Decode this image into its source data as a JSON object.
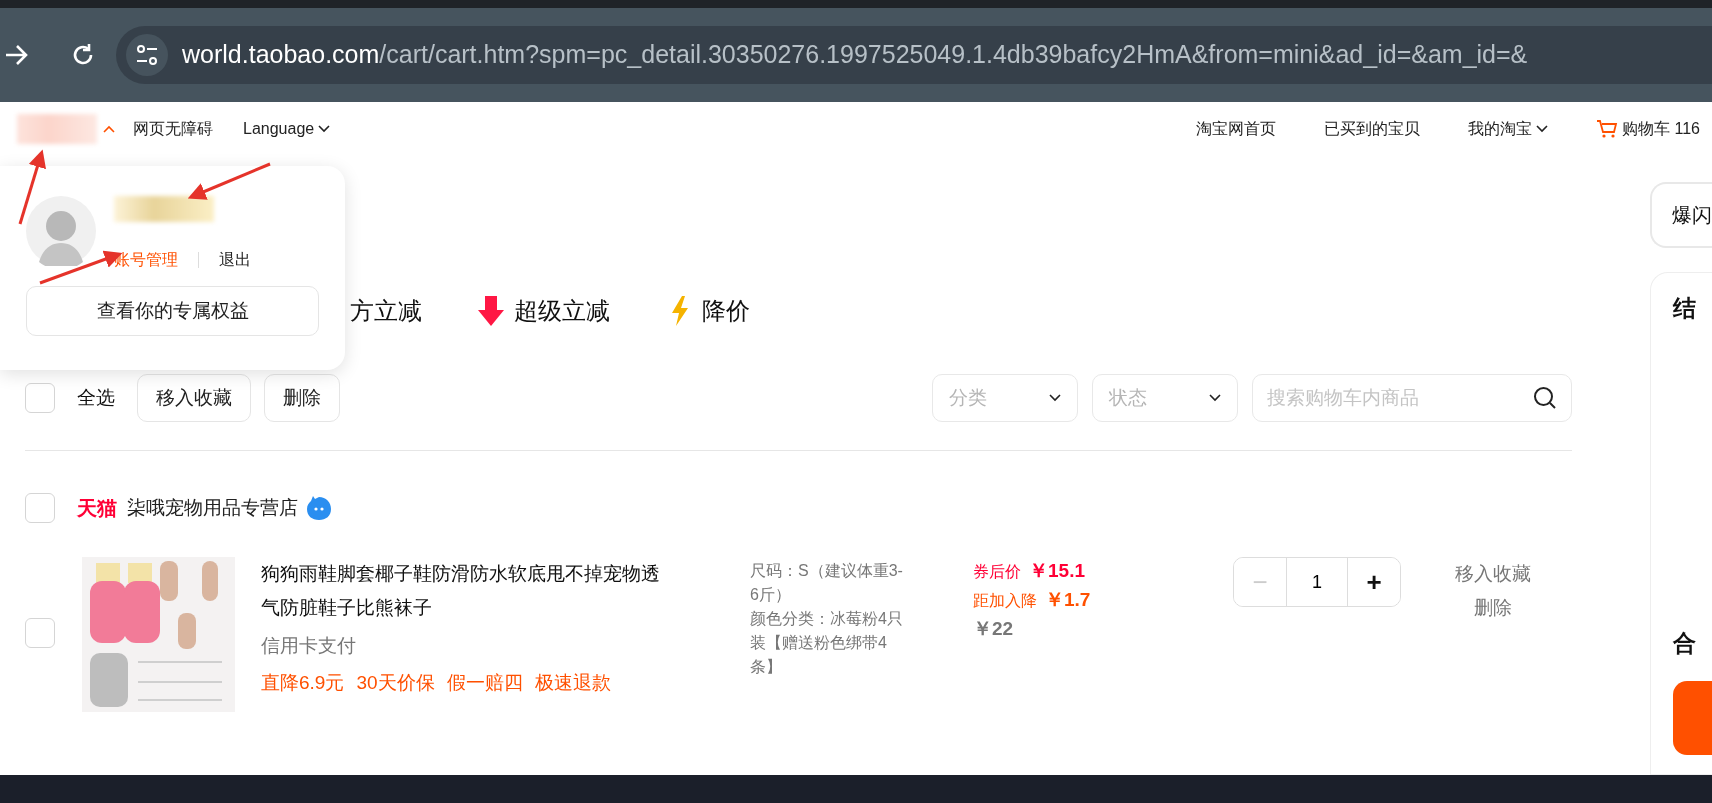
{
  "browser": {
    "url_host": "world.taobao.com",
    "url_path": "/cart/cart.htm?spm=pc_detail.30350276.1997525049.1.4db39bafcy2HmA&from=mini&ad_id=&am_id=&"
  },
  "top_nav": {
    "left": [
      {
        "label": "网页无障碍",
        "kind": "link"
      },
      {
        "label": "Language",
        "kind": "dropdown"
      }
    ],
    "right": [
      {
        "label": "淘宝网首页",
        "kind": "link"
      },
      {
        "label": "已买到的宝贝",
        "kind": "link"
      },
      {
        "label": "我的淘宝",
        "kind": "dropdown"
      },
      {
        "label": "购物车 116",
        "kind": "cart"
      }
    ]
  },
  "account_popup": {
    "manage": "账号管理",
    "logout": "退出",
    "benefits_button": "查看你的专属权益"
  },
  "promos": [
    {
      "label": "方立减",
      "kind": "plain"
    },
    {
      "label": "超级立减",
      "kind": "arrow"
    },
    {
      "label": "降价",
      "kind": "bolt"
    }
  ],
  "toolbar": {
    "select_all": {
      "label": "全选",
      "checked": false
    },
    "buttons": [
      "移入收藏",
      "删除"
    ],
    "filters": [
      "分类",
      "状态"
    ],
    "search": {
      "placeholder": "搜索购物车内商品"
    }
  },
  "stores": [
    {
      "badge": "天猫",
      "name": "柒哦宠物用品专营店",
      "checked": false,
      "items": [
        {
          "checked": false,
          "title": "狗狗雨鞋脚套椰子鞋防滑防水软底甩不掉宠物透气防脏鞋子比熊袜子",
          "payment": "信用卡支付",
          "tags": [
            "直降6.9元",
            "30天价保",
            "假一赔四",
            "极速退款"
          ],
          "sku": [
            "尺码：S（建议体重3-6斤）",
            "颜色分类：冰莓粉4只装【赠送粉色绑带4条】"
          ],
          "prices": [
            {
              "label": "券后价",
              "value": "￥15.1",
              "kind": "coupon"
            },
            {
              "label": "距加入降",
              "value": "￥1.7",
              "kind": "drop"
            },
            {
              "value": "￥22",
              "kind": "original"
            }
          ],
          "quantity": "1",
          "minus": "−",
          "plus": "+",
          "minus_disabled": true,
          "actions": [
            "移入收藏",
            "删除"
          ]
        }
      ]
    }
  ],
  "summary": {
    "promo_card": "爆闪",
    "title": "结",
    "total": "合"
  }
}
